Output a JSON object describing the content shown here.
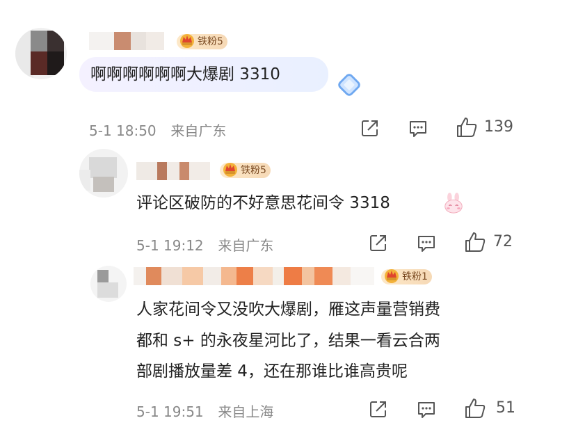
{
  "comments": [
    {
      "badge": "铁粉5",
      "text": "啊啊啊啊啊啊大爆剧 3310",
      "time": "5-1 18:50",
      "location": "来自广东",
      "likes": "139"
    },
    {
      "badge": "铁粉5",
      "text": "评论区破防的不好意思花间令 3318",
      "time": "5-1 19:12",
      "location": "来自广东",
      "likes": "72"
    },
    {
      "badge": "铁粉1",
      "text_lines": [
        "人家花间令又没吹大爆剧，雁这声量营销费",
        "都和 s+ 的永夜星河比了，结果一看云合两",
        "部剧播放量差 4，还在那谁比谁高贵呢"
      ],
      "time": "5-1 19:51",
      "location": "来自上海",
      "likes": "51"
    }
  ],
  "icons": [
    "crown-icon",
    "share-icon",
    "comment-icon",
    "like-icon",
    "emoji-bunny-icon",
    "sticker-diamond-icon"
  ],
  "colors": {
    "badge_bg": "#fbe3c3",
    "badge_text": "#7a4a22",
    "meta": "#888888",
    "bubble": "#eef0ff"
  }
}
